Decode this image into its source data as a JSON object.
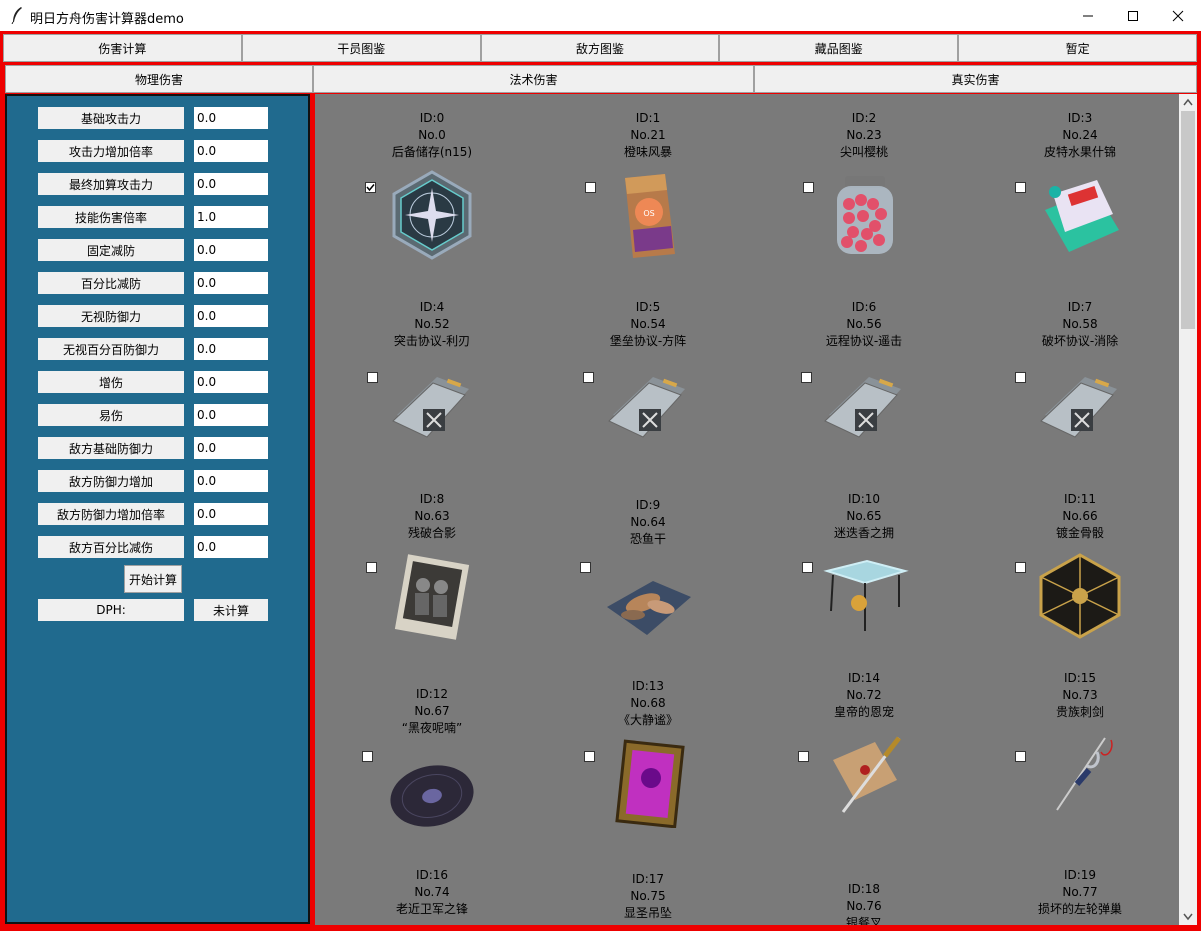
{
  "window": {
    "title": "明日方舟伤害计算器demo"
  },
  "main_tabs": [
    "伤害计算",
    "干员图鉴",
    "敌方图鉴",
    "藏品图鉴",
    "暂定"
  ],
  "damage_tabs": [
    "物理伤害",
    "法术伤害",
    "真实伤害"
  ],
  "fields": [
    {
      "label": "基础攻击力",
      "value": "0.0"
    },
    {
      "label": "攻击力增加倍率",
      "value": "0.0"
    },
    {
      "label": "最终加算攻击力",
      "value": "0.0"
    },
    {
      "label": "技能伤害倍率",
      "value": "1.0"
    },
    {
      "label": "固定减防",
      "value": "0.0"
    },
    {
      "label": "百分比减防",
      "value": "0.0"
    },
    {
      "label": "无视防御力",
      "value": "0.0"
    },
    {
      "label": "无视百分百防御力",
      "value": "0.0"
    },
    {
      "label": "增伤",
      "value": "0.0"
    },
    {
      "label": "易伤",
      "value": "0.0"
    },
    {
      "label": "敌方基础防御力",
      "value": "0.0"
    },
    {
      "label": "敌方防御力增加",
      "value": "0.0"
    },
    {
      "label": "敌方防御力增加倍率",
      "value": "0.0"
    },
    {
      "label": "敌方百分比减伤",
      "value": "0.0"
    }
  ],
  "calc_button": "开始计算",
  "dph": {
    "label": "DPH:",
    "value": "未计算"
  },
  "items": [
    {
      "id": "ID:0",
      "no": "No.0",
      "name": "后备储存(n15)",
      "checked": true,
      "icon": "compass-badge-icon"
    },
    {
      "id": "ID:1",
      "no": "No.21",
      "name": "橙味风暴",
      "checked": false,
      "icon": "snack-bag-icon"
    },
    {
      "id": "ID:2",
      "no": "No.23",
      "name": "尖叫樱桃",
      "checked": false,
      "icon": "cherry-jar-icon"
    },
    {
      "id": "ID:3",
      "no": "No.24",
      "name": "皮特水果什锦",
      "checked": false,
      "icon": "fruit-pack-icon"
    },
    {
      "id": "ID:4",
      "no": "No.52",
      "name": "突击协议-利刃",
      "checked": false,
      "icon": "protocol-card-icon"
    },
    {
      "id": "ID:5",
      "no": "No.54",
      "name": "堡垒协议-方阵",
      "checked": false,
      "icon": "protocol-card-icon"
    },
    {
      "id": "ID:6",
      "no": "No.56",
      "name": "远程协议-遥击",
      "checked": false,
      "icon": "protocol-card-icon"
    },
    {
      "id": "ID:7",
      "no": "No.58",
      "name": "破坏协议-消除",
      "checked": false,
      "icon": "protocol-card-icon"
    },
    {
      "id": "ID:8",
      "no": "No.63",
      "name": "残破合影",
      "checked": false,
      "icon": "photo-icon"
    },
    {
      "id": "ID:9",
      "no": "No.64",
      "name": "恐鱼干",
      "checked": false,
      "icon": "dried-fish-icon"
    },
    {
      "id": "ID:10",
      "no": "No.65",
      "name": "迷迭香之拥",
      "checked": false,
      "icon": "stand-icon"
    },
    {
      "id": "ID:11",
      "no": "No.66",
      "name": "镀金骨骰",
      "checked": false,
      "icon": "dice-icon"
    },
    {
      "id": "ID:12",
      "no": "No.67",
      "name": "“黑夜呢喃”",
      "checked": false,
      "icon": "vinyl-record-icon"
    },
    {
      "id": "ID:13",
      "no": "No.68",
      "name": "《大静谧》",
      "checked": false,
      "icon": "painting-icon"
    },
    {
      "id": "ID:14",
      "no": "No.72",
      "name": "皇帝的恩宠",
      "checked": false,
      "icon": "letter-dagger-icon"
    },
    {
      "id": "ID:15",
      "no": "No.73",
      "name": "贵族刺剑",
      "checked": false,
      "icon": "rapier-icon"
    },
    {
      "id": "ID:16",
      "no": "No.74",
      "name": "老近卫军之锋",
      "checked": false,
      "icon": "none"
    },
    {
      "id": "ID:17",
      "no": "No.75",
      "name": "显圣吊坠",
      "checked": false,
      "icon": "none"
    },
    {
      "id": "ID:18",
      "no": "No.76",
      "name": "银餐叉",
      "checked": false,
      "icon": "none"
    },
    {
      "id": "ID:19",
      "no": "No.77",
      "name": "损坏的左轮弹巢",
      "checked": false,
      "icon": "none"
    }
  ]
}
